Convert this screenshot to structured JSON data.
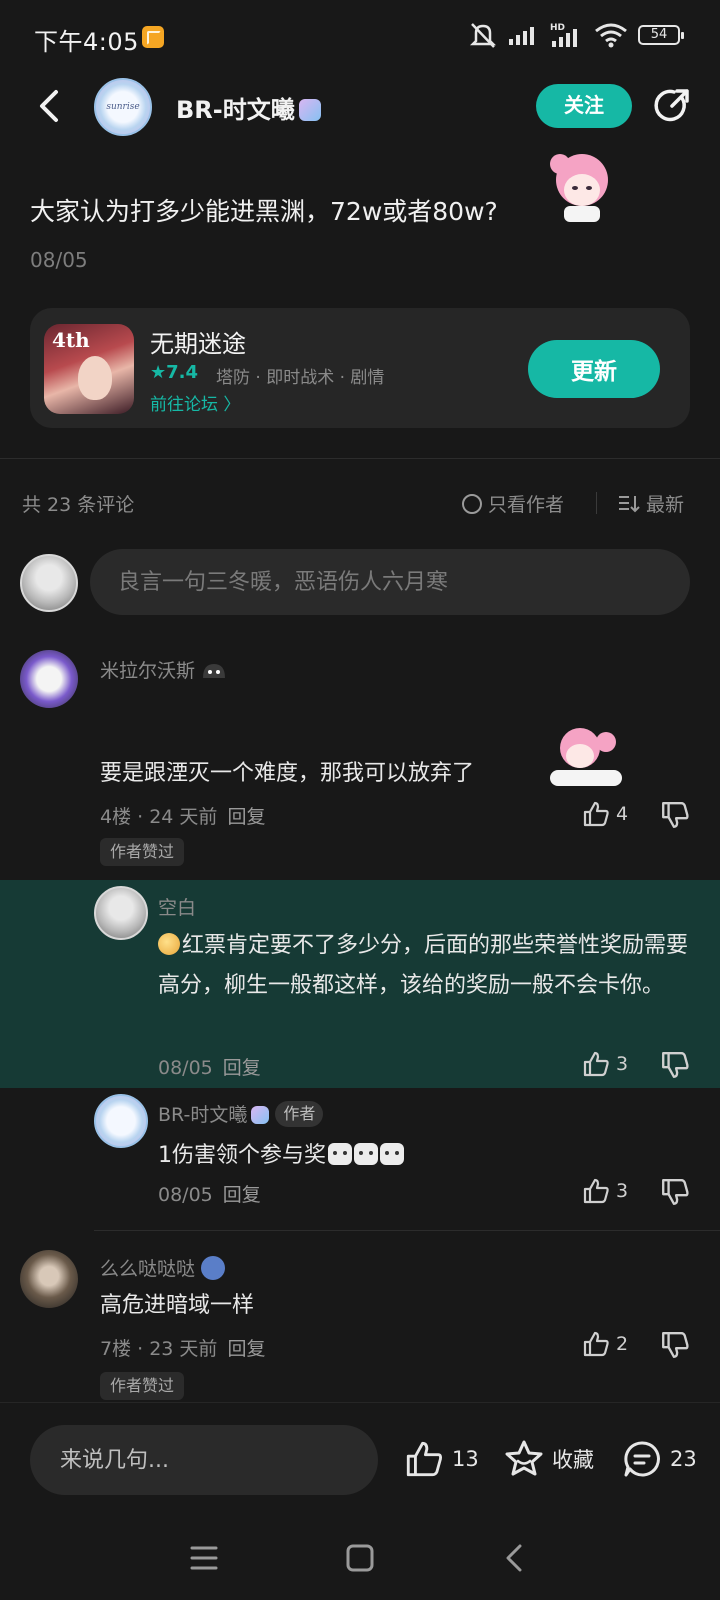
{
  "status_bar": {
    "time": "下午4:05",
    "battery": "54"
  },
  "header": {
    "author_name": "BR-时文曦",
    "avatar_text": "sunrise",
    "follow_label": "关注"
  },
  "post": {
    "title": "大家认为打多少能进黑渊，72w或者80w?",
    "date": "08/05"
  },
  "game_card": {
    "name": "无期迷途",
    "icon_text": "4th",
    "rating": "★7.4",
    "tags": "塔防 · 即时战术 · 剧情",
    "forum_link": "前往论坛 〉",
    "update_label": "更新"
  },
  "comments_header": {
    "count_label": "共 23 条评论",
    "only_author_label": "只看作者",
    "sort_label": "最新"
  },
  "comment_input": {
    "placeholder": "良言一句三冬暖，恶语伤人六月寒"
  },
  "comments": [
    {
      "user": "米拉尔沃斯",
      "text": "要是跟湮灭一个难度，那我可以放弃了",
      "floor": "4楼",
      "time": "24 天前",
      "reply_label": "回复",
      "likes": "4",
      "author_liked": "作者赞过",
      "replies": [
        {
          "user": "空白",
          "text": "红票肯定要不了多少分，后面的那些荣誉性奖励需要高分，柳生一般都这样，该给的奖励一般不会卡你。",
          "date": "08/05",
          "reply_label": "回复",
          "likes": "3"
        },
        {
          "user": "BR-时文曦",
          "author_tag": "作者",
          "text": "1伤害领个参与奖",
          "date": "08/05",
          "reply_label": "回复",
          "likes": "3"
        }
      ]
    },
    {
      "user": "么么哒哒哒",
      "text": "高危进暗域一样",
      "floor": "7楼",
      "time": "23 天前",
      "reply_label": "回复",
      "likes": "2",
      "author_liked": "作者赞过"
    }
  ],
  "bottom_bar": {
    "placeholder": "来说几句...",
    "likes": "13",
    "favorite_label": "收藏",
    "comments": "23"
  }
}
